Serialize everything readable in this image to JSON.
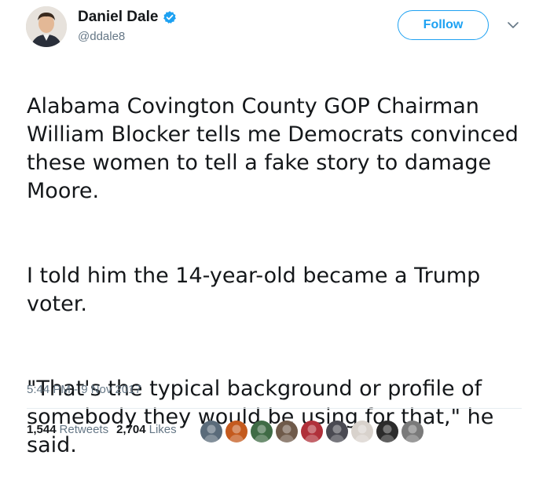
{
  "author": {
    "display_name": "Daniel Dale",
    "handle": "@ddale8",
    "verified": true,
    "avatar_icon": "profile-photo-icon"
  },
  "actions": {
    "follow_label": "Follow",
    "menu_icon": "chevron-down-icon"
  },
  "tweet": {
    "paragraphs": [
      "Alabama Covington County GOP Chairman William Blocker tells me Democrats convinced these women to tell a fake story to damage Moore.",
      "I told him the 14-year-old became a Trump voter.",
      "\"That's the typical background or profile of somebody they would be using for that,\" he said."
    ],
    "timestamp": "5:44 PM - 9 Nov 2017"
  },
  "stats": {
    "retweets_count": "1,544",
    "retweets_label": "Retweets",
    "likes_count": "2,704",
    "likes_label": "Likes"
  },
  "likers": [
    {
      "icon": "liker-avatar-1",
      "color": "#5a6b7a"
    },
    {
      "icon": "liker-avatar-2",
      "color": "#c45a1e"
    },
    {
      "icon": "liker-avatar-3",
      "color": "#3f6b45"
    },
    {
      "icon": "liker-avatar-4",
      "color": "#6f5a4a"
    },
    {
      "icon": "liker-avatar-5",
      "color": "#b0303a"
    },
    {
      "icon": "liker-avatar-6",
      "color": "#4a4a52"
    },
    {
      "icon": "liker-avatar-7",
      "color": "#d8d2cc"
    },
    {
      "icon": "liker-avatar-8",
      "color": "#2b2b2b"
    },
    {
      "icon": "liker-avatar-9",
      "color": "#7a7a7a"
    }
  ],
  "colors": {
    "accent": "#1da1f2",
    "secondary_text": "#657786",
    "primary_text": "#14171a",
    "divider": "#e6ecf0"
  }
}
